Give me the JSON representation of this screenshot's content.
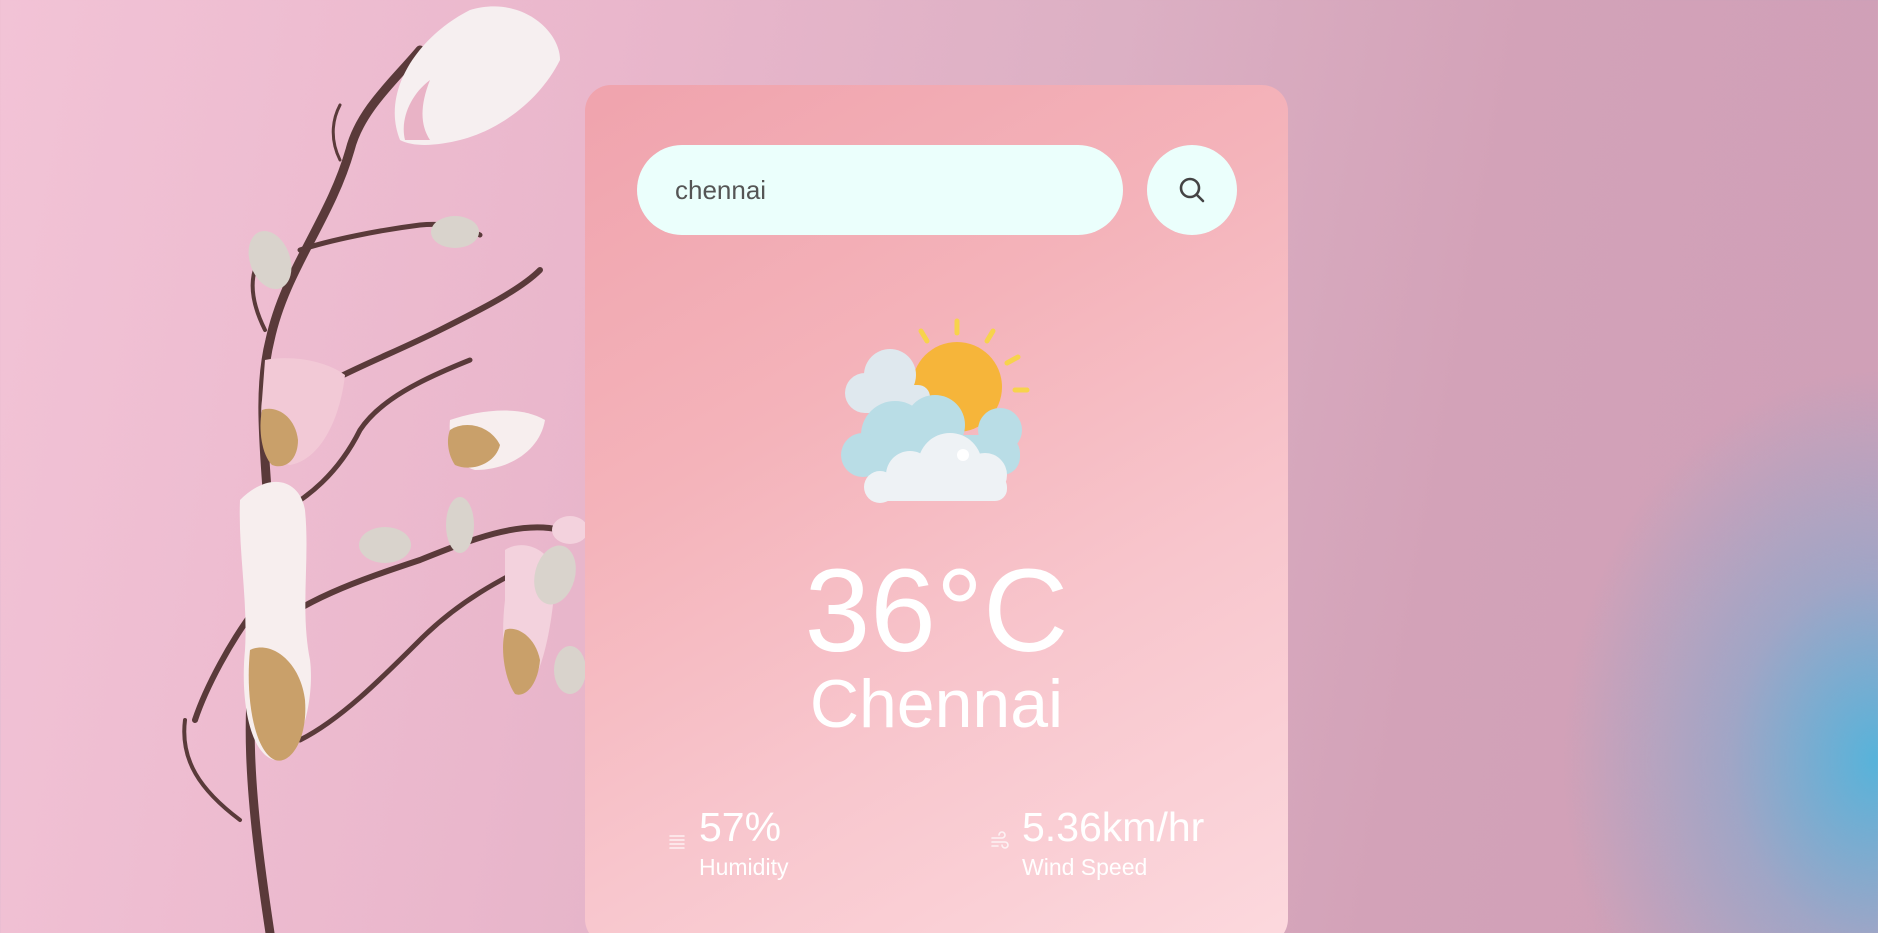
{
  "search": {
    "value": "chennai"
  },
  "weather": {
    "icon": "partly-cloudy-icon",
    "temperature": "36°C",
    "city": "Chennai"
  },
  "stats": {
    "humidity": {
      "value": "57%",
      "label": "Humidity",
      "icon": "humidity-icon"
    },
    "wind": {
      "value": "5.36km/hr",
      "label": "Wind Speed",
      "icon": "wind-icon"
    }
  },
  "colors": {
    "card_top": "#f0a3ad",
    "card_bottom": "#fcd9de",
    "input_bg": "#ebfffc",
    "text": "#ffffff"
  }
}
